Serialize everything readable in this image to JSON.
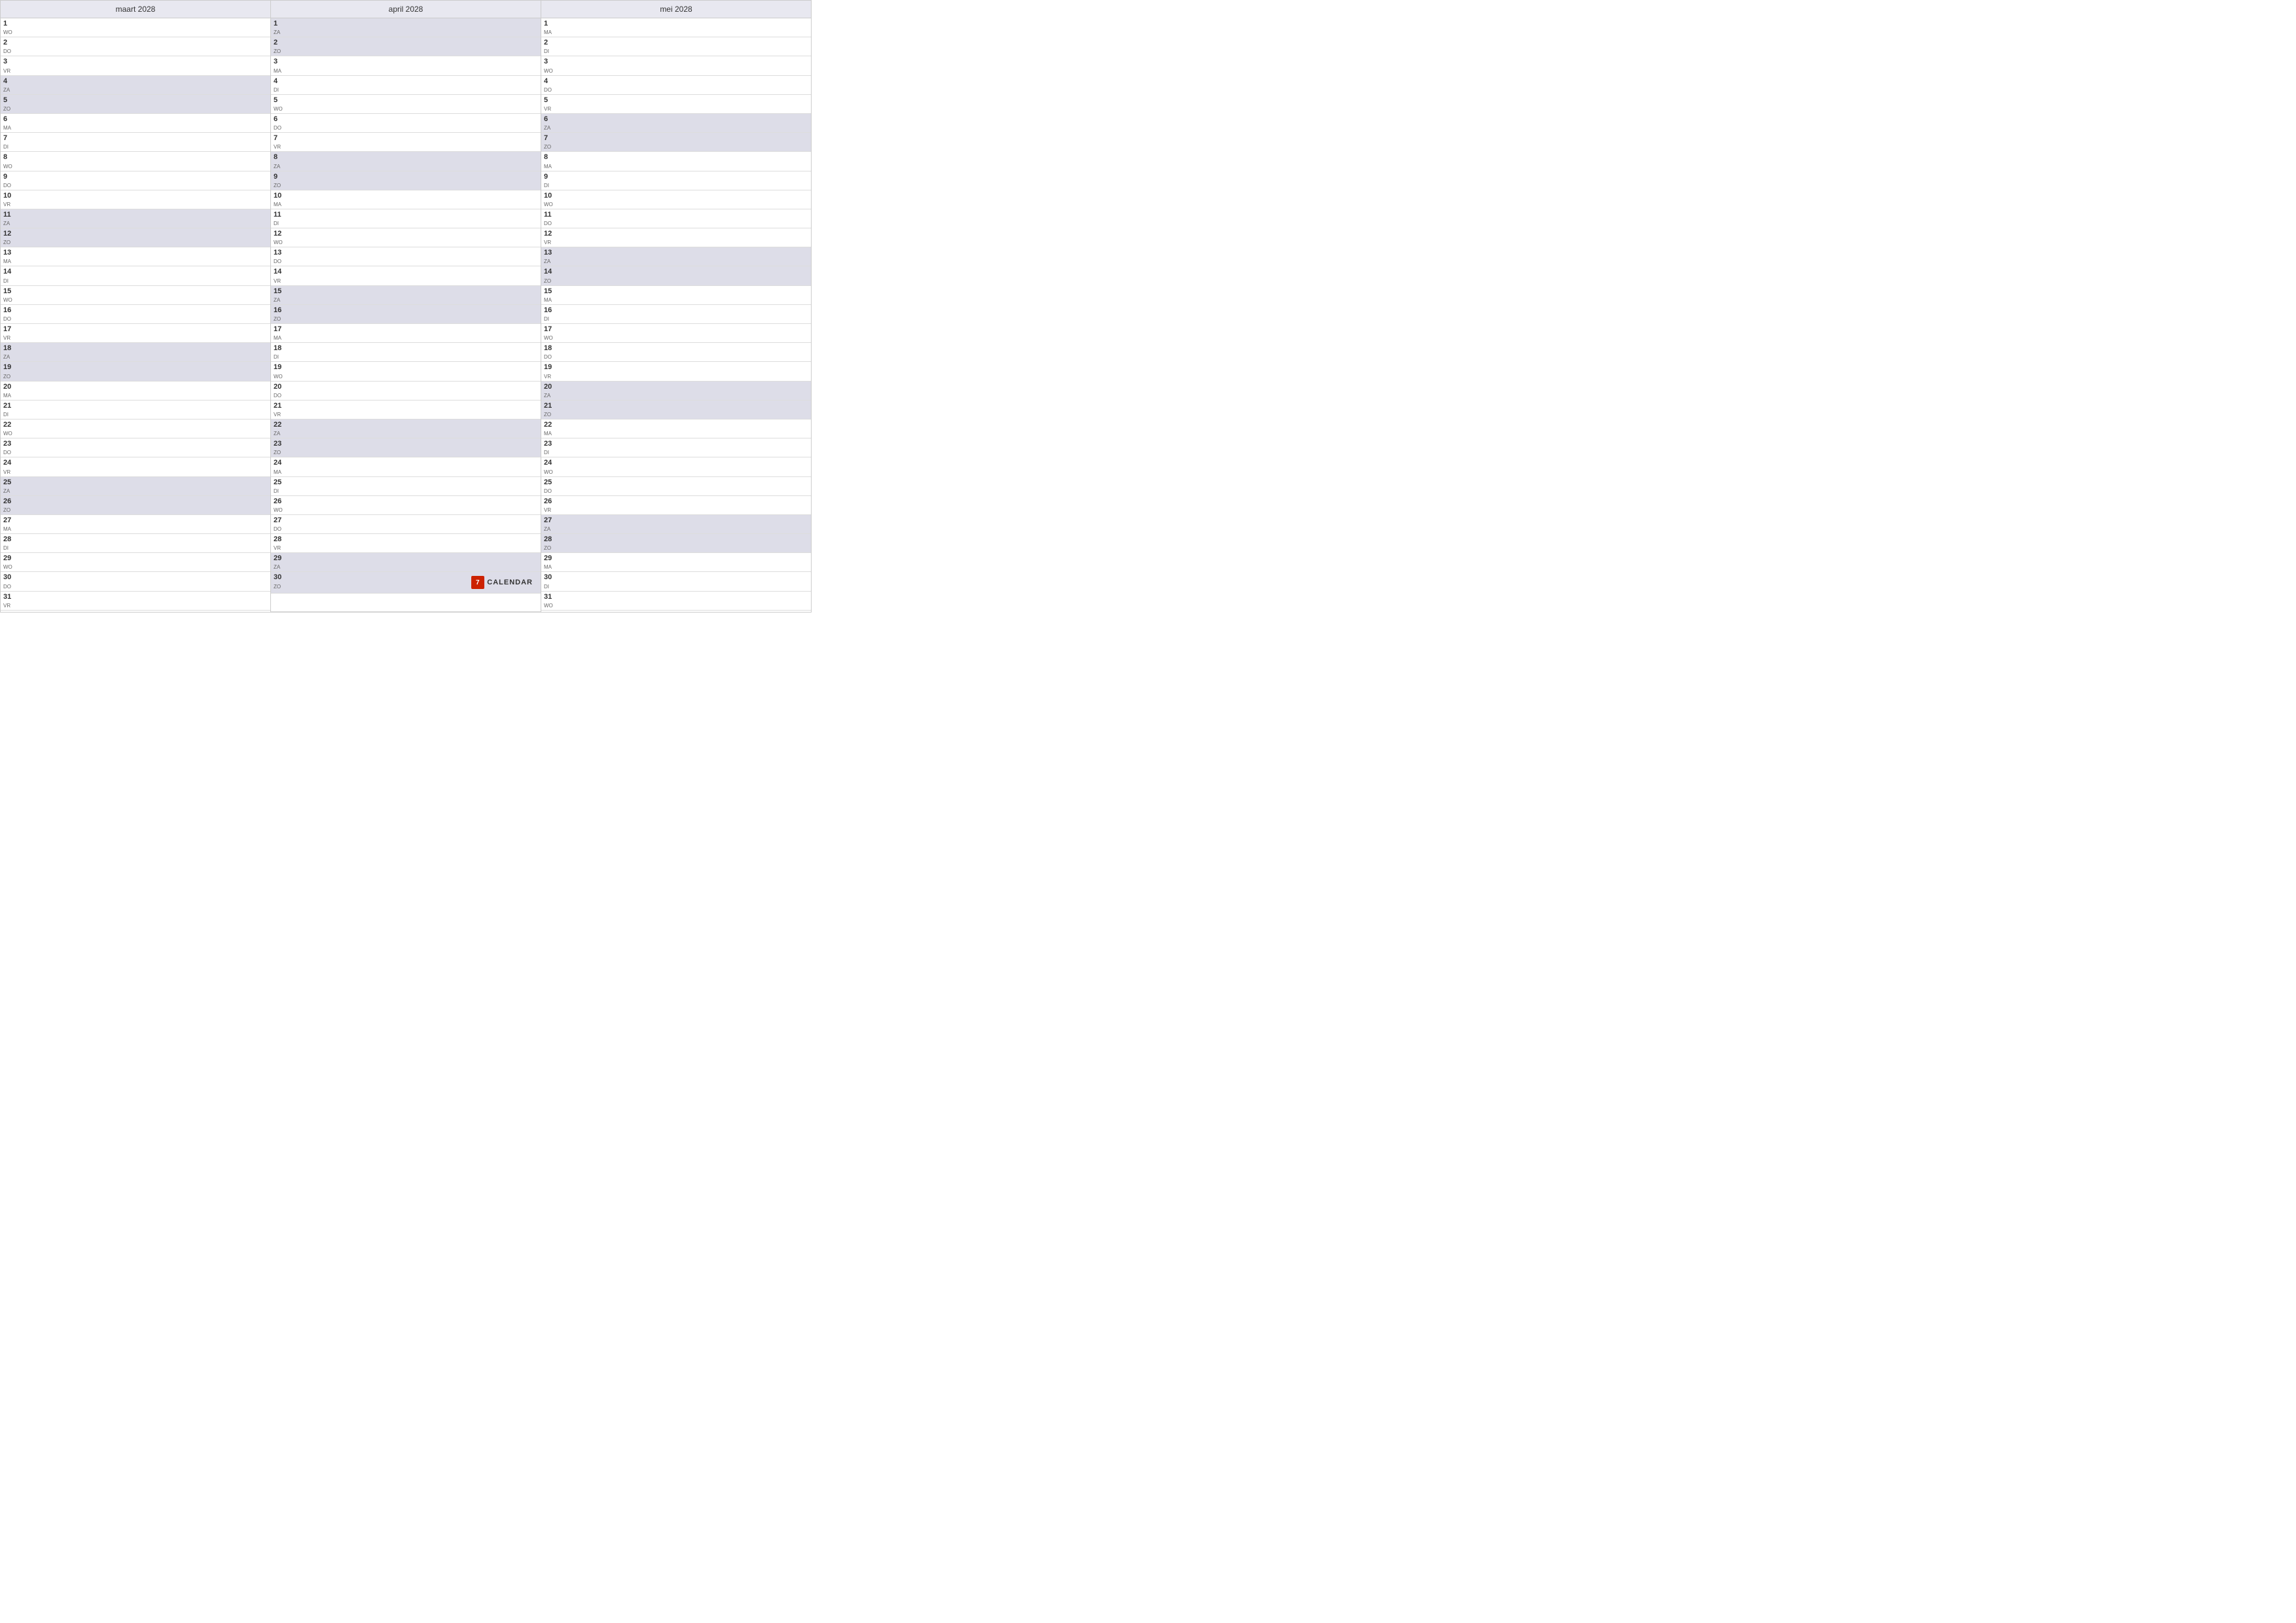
{
  "months": [
    {
      "name": "maart 2028",
      "days": [
        {
          "num": "1",
          "day": "WO",
          "weekend": false
        },
        {
          "num": "2",
          "day": "DO",
          "weekend": false
        },
        {
          "num": "3",
          "day": "VR",
          "weekend": false
        },
        {
          "num": "4",
          "day": "ZA",
          "weekend": true
        },
        {
          "num": "5",
          "day": "ZO",
          "weekend": true
        },
        {
          "num": "6",
          "day": "MA",
          "weekend": false
        },
        {
          "num": "7",
          "day": "DI",
          "weekend": false
        },
        {
          "num": "8",
          "day": "WO",
          "weekend": false
        },
        {
          "num": "9",
          "day": "DO",
          "weekend": false
        },
        {
          "num": "10",
          "day": "VR",
          "weekend": false
        },
        {
          "num": "11",
          "day": "ZA",
          "weekend": true
        },
        {
          "num": "12",
          "day": "ZO",
          "weekend": true
        },
        {
          "num": "13",
          "day": "MA",
          "weekend": false
        },
        {
          "num": "14",
          "day": "DI",
          "weekend": false
        },
        {
          "num": "15",
          "day": "WO",
          "weekend": false
        },
        {
          "num": "16",
          "day": "DO",
          "weekend": false
        },
        {
          "num": "17",
          "day": "VR",
          "weekend": false
        },
        {
          "num": "18",
          "day": "ZA",
          "weekend": true
        },
        {
          "num": "19",
          "day": "ZO",
          "weekend": true
        },
        {
          "num": "20",
          "day": "MA",
          "weekend": false
        },
        {
          "num": "21",
          "day": "DI",
          "weekend": false
        },
        {
          "num": "22",
          "day": "WO",
          "weekend": false
        },
        {
          "num": "23",
          "day": "DO",
          "weekend": false
        },
        {
          "num": "24",
          "day": "VR",
          "weekend": false
        },
        {
          "num": "25",
          "day": "ZA",
          "weekend": true
        },
        {
          "num": "26",
          "day": "ZO",
          "weekend": true
        },
        {
          "num": "27",
          "day": "MA",
          "weekend": false
        },
        {
          "num": "28",
          "day": "DI",
          "weekend": false
        },
        {
          "num": "29",
          "day": "WO",
          "weekend": false
        },
        {
          "num": "30",
          "day": "DO",
          "weekend": false
        },
        {
          "num": "31",
          "day": "VR",
          "weekend": false
        }
      ]
    },
    {
      "name": "april 2028",
      "days": [
        {
          "num": "1",
          "day": "ZA",
          "weekend": true
        },
        {
          "num": "2",
          "day": "ZO",
          "weekend": true
        },
        {
          "num": "3",
          "day": "MA",
          "weekend": false
        },
        {
          "num": "4",
          "day": "DI",
          "weekend": false
        },
        {
          "num": "5",
          "day": "WO",
          "weekend": false
        },
        {
          "num": "6",
          "day": "DO",
          "weekend": false
        },
        {
          "num": "7",
          "day": "VR",
          "weekend": false
        },
        {
          "num": "8",
          "day": "ZA",
          "weekend": true
        },
        {
          "num": "9",
          "day": "ZO",
          "weekend": true
        },
        {
          "num": "10",
          "day": "MA",
          "weekend": false
        },
        {
          "num": "11",
          "day": "DI",
          "weekend": false
        },
        {
          "num": "12",
          "day": "WO",
          "weekend": false
        },
        {
          "num": "13",
          "day": "DO",
          "weekend": false
        },
        {
          "num": "14",
          "day": "VR",
          "weekend": false
        },
        {
          "num": "15",
          "day": "ZA",
          "weekend": true
        },
        {
          "num": "16",
          "day": "ZO",
          "weekend": true
        },
        {
          "num": "17",
          "day": "MA",
          "weekend": false
        },
        {
          "num": "18",
          "day": "DI",
          "weekend": false
        },
        {
          "num": "19",
          "day": "WO",
          "weekend": false
        },
        {
          "num": "20",
          "day": "DO",
          "weekend": false
        },
        {
          "num": "21",
          "day": "VR",
          "weekend": false
        },
        {
          "num": "22",
          "day": "ZA",
          "weekend": true
        },
        {
          "num": "23",
          "day": "ZO",
          "weekend": true
        },
        {
          "num": "24",
          "day": "MA",
          "weekend": false
        },
        {
          "num": "25",
          "day": "DI",
          "weekend": false
        },
        {
          "num": "26",
          "day": "WO",
          "weekend": false
        },
        {
          "num": "27",
          "day": "DO",
          "weekend": false
        },
        {
          "num": "28",
          "day": "VR",
          "weekend": false
        },
        {
          "num": "29",
          "day": "ZA",
          "weekend": true
        },
        {
          "num": "30",
          "day": "ZO",
          "weekend": true
        }
      ]
    },
    {
      "name": "mei 2028",
      "days": [
        {
          "num": "1",
          "day": "MA",
          "weekend": false
        },
        {
          "num": "2",
          "day": "DI",
          "weekend": false
        },
        {
          "num": "3",
          "day": "WO",
          "weekend": false
        },
        {
          "num": "4",
          "day": "DO",
          "weekend": false
        },
        {
          "num": "5",
          "day": "VR",
          "weekend": false
        },
        {
          "num": "6",
          "day": "ZA",
          "weekend": true
        },
        {
          "num": "7",
          "day": "ZO",
          "weekend": true
        },
        {
          "num": "8",
          "day": "MA",
          "weekend": false
        },
        {
          "num": "9",
          "day": "DI",
          "weekend": false
        },
        {
          "num": "10",
          "day": "WO",
          "weekend": false
        },
        {
          "num": "11",
          "day": "DO",
          "weekend": false
        },
        {
          "num": "12",
          "day": "VR",
          "weekend": false
        },
        {
          "num": "13",
          "day": "ZA",
          "weekend": true
        },
        {
          "num": "14",
          "day": "ZO",
          "weekend": true
        },
        {
          "num": "15",
          "day": "MA",
          "weekend": false
        },
        {
          "num": "16",
          "day": "DI",
          "weekend": false
        },
        {
          "num": "17",
          "day": "WO",
          "weekend": false
        },
        {
          "num": "18",
          "day": "DO",
          "weekend": false
        },
        {
          "num": "19",
          "day": "VR",
          "weekend": false
        },
        {
          "num": "20",
          "day": "ZA",
          "weekend": true
        },
        {
          "num": "21",
          "day": "ZO",
          "weekend": true
        },
        {
          "num": "22",
          "day": "MA",
          "weekend": false
        },
        {
          "num": "23",
          "day": "DI",
          "weekend": false
        },
        {
          "num": "24",
          "day": "WO",
          "weekend": false
        },
        {
          "num": "25",
          "day": "DO",
          "weekend": false
        },
        {
          "num": "26",
          "day": "VR",
          "weekend": false
        },
        {
          "num": "27",
          "day": "ZA",
          "weekend": true
        },
        {
          "num": "28",
          "day": "ZO",
          "weekend": true
        },
        {
          "num": "29",
          "day": "MA",
          "weekend": false
        },
        {
          "num": "30",
          "day": "DI",
          "weekend": false
        },
        {
          "num": "31",
          "day": "WO",
          "weekend": false
        }
      ]
    }
  ],
  "footer": {
    "logo_number": "7",
    "logo_text": "CALENDAR"
  }
}
